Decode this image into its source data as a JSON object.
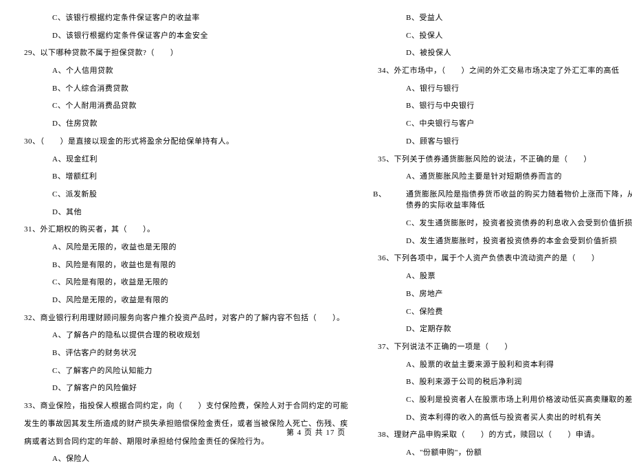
{
  "left": {
    "pre": [
      {
        "k": "opt",
        "text": "C、该银行根据约定条件保证客户的收益率"
      },
      {
        "k": "opt",
        "text": "D、该银行根据约定条件保证客户的本金安全"
      }
    ],
    "q29": {
      "stem": "29、以下哪种贷款不属于担保贷款?（　　）",
      "opts": [
        "A、个人信用贷款",
        "B、个人综合消费贷款",
        "C、个人耐用消费品贷款",
        "D、住房贷款"
      ]
    },
    "q30": {
      "stem": "30、（　　）是直接以现金的形式将盈余分配给保单持有人。",
      "opts": [
        "A、现金红利",
        "B、增额红利",
        "C、派发新股",
        "D、其他"
      ]
    },
    "q31": {
      "stem": "31、外汇期权的购买者，其（　　）。",
      "opts": [
        "A、风险是无限的，收益也是无限的",
        "B、风险是有限的，收益也是有限的",
        "C、风险是有限的，收益是无限的",
        "D、风险是无限的，收益是有限的"
      ]
    },
    "q32": {
      "stem": "32、商业银行利用理财顾问服务向客户推介投资产品时，对客户的了解内容不包括（　　）。",
      "opts": [
        "A、了解各户的隐私以提供合理的税收规划",
        "B、评估客户的财务状况",
        "C、了解客户的风险认知能力",
        "D、了解客户的风险偏好"
      ]
    },
    "q33": {
      "stem": "33、商业保险，指投保人根据合同约定，向（　　）支付保险费，保险人对于合同约定的可能",
      "cont": [
        "发生的事故因其发生所造成的财产损失承担赔偿保险金责任，或者当被保险人死亡、伤残、疾",
        "病或者达到合同约定的年龄、期限时承担给付保险金责任的保险行为。"
      ],
      "opts": [
        "A、保险人"
      ]
    }
  },
  "right": {
    "pre": [
      {
        "k": "opt",
        "text": "B、受益人"
      },
      {
        "k": "opt",
        "text": "C、投保人"
      },
      {
        "k": "opt",
        "text": "D、被投保人"
      }
    ],
    "q34": {
      "stem": "34、外汇市场中，（　　）之间的外汇交易市场决定了外汇汇率的高低",
      "opts": [
        "A、银行与银行",
        "B、银行与中央银行",
        "C、中央银行与客户",
        "D、顾客与银行"
      ]
    },
    "q35": {
      "stem": "35、下列关于债券通货膨胀风险的说法，不正确的是（　　）",
      "opts": [
        "A、通货膨胀风险主要是针对短期债券而言的"
      ],
      "wrap": {
        "head": "B、",
        "text": "通货膨胀风险是指债券货币收益的购买力随着物价上涨而下降，从而使债券的实际收益率降低"
      },
      "opts2": [
        "C、发生通货膨胀时，投资者投资债券的利息收入会受到价值折损",
        "D、发生通货膨胀时，投资者投资债券的本金会受到价值折损"
      ]
    },
    "q36": {
      "stem": "36、下列各项中，属于个人资产负债表中流动资产的是（　　）",
      "opts": [
        "A、股票",
        "B、房地产",
        "C、保险费",
        "D、定期存款"
      ]
    },
    "q37": {
      "stem": "37、下列说法不正确的一项是（　　）",
      "opts": [
        "A、股票的收益主要来源于股利和资本利得",
        "B、股利来源于公司的税后净利润",
        "C、股利是投资者人在股票市场上利用价格波动低买高卖赚取的差价收入",
        "D、资本利得的收入的高低与投资者买人卖出的时机有关"
      ]
    },
    "q38": {
      "stem": "38、理财产品申购采取（　　）的方式，赎回以（　　）申请。",
      "opts": [
        "A、\"份额申购\"，份额"
      ]
    }
  },
  "footer": "第 4 页 共 17 页"
}
